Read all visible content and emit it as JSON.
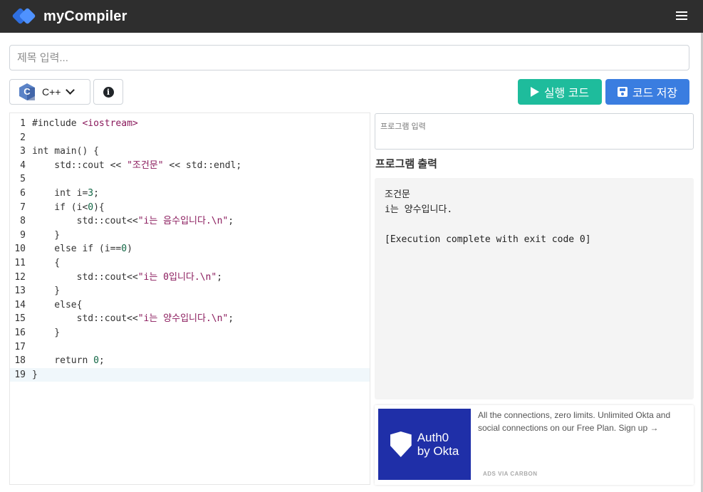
{
  "header": {
    "brand_name": "myCompiler",
    "menu_icon": "hamburger-menu-icon"
  },
  "title_input": {
    "placeholder": "제목 입력...",
    "value": ""
  },
  "toolbar": {
    "language_label": "C++",
    "language_icon": "cpp-icon",
    "info_icon": "info-icon",
    "run_label": "실행 코드",
    "save_label": "코드 저장"
  },
  "colors": {
    "header_bg": "#2e2e2e",
    "run_button": "#1ebc9c",
    "save_button": "#3a7de0",
    "ad_bg": "#1f2fa8"
  },
  "editor": {
    "active_line": 19,
    "lines": [
      {
        "n": "1",
        "parts": [
          {
            "t": "#include ",
            "c": ""
          },
          {
            "t": "<iostream>",
            "c": "str"
          }
        ]
      },
      {
        "n": "2",
        "parts": [
          {
            "t": "",
            "c": ""
          }
        ]
      },
      {
        "n": "3",
        "parts": [
          {
            "t": "int main() {",
            "c": ""
          }
        ]
      },
      {
        "n": "4",
        "parts": [
          {
            "t": "    std::cout << ",
            "c": ""
          },
          {
            "t": "\"조건문\"",
            "c": "str"
          },
          {
            "t": " << std::endl;",
            "c": ""
          }
        ]
      },
      {
        "n": "5",
        "parts": [
          {
            "t": "",
            "c": ""
          }
        ]
      },
      {
        "n": "6",
        "parts": [
          {
            "t": "    int i=",
            "c": ""
          },
          {
            "t": "3",
            "c": "num"
          },
          {
            "t": ";",
            "c": ""
          }
        ]
      },
      {
        "n": "7",
        "parts": [
          {
            "t": "    if (i<",
            "c": ""
          },
          {
            "t": "0",
            "c": "num"
          },
          {
            "t": "){",
            "c": ""
          }
        ]
      },
      {
        "n": "8",
        "parts": [
          {
            "t": "        std::cout<<",
            "c": ""
          },
          {
            "t": "\"i는 음수입니다.\\n\"",
            "c": "str"
          },
          {
            "t": ";",
            "c": ""
          }
        ]
      },
      {
        "n": "9",
        "parts": [
          {
            "t": "    }",
            "c": ""
          }
        ]
      },
      {
        "n": "10",
        "parts": [
          {
            "t": "    else if (i==",
            "c": ""
          },
          {
            "t": "0",
            "c": "num"
          },
          {
            "t": ")",
            "c": ""
          }
        ]
      },
      {
        "n": "11",
        "parts": [
          {
            "t": "    {",
            "c": ""
          }
        ]
      },
      {
        "n": "12",
        "parts": [
          {
            "t": "        std::cout<<",
            "c": ""
          },
          {
            "t": "\"i는 0입니다.\\n\"",
            "c": "str"
          },
          {
            "t": ";",
            "c": ""
          }
        ]
      },
      {
        "n": "13",
        "parts": [
          {
            "t": "    }",
            "c": ""
          }
        ]
      },
      {
        "n": "14",
        "parts": [
          {
            "t": "    else{",
            "c": ""
          }
        ]
      },
      {
        "n": "15",
        "parts": [
          {
            "t": "        std::cout<<",
            "c": ""
          },
          {
            "t": "\"i는 양수입니다.\\n\"",
            "c": "str"
          },
          {
            "t": ";",
            "c": ""
          }
        ]
      },
      {
        "n": "16",
        "parts": [
          {
            "t": "    }",
            "c": ""
          }
        ]
      },
      {
        "n": "17",
        "parts": [
          {
            "t": "",
            "c": ""
          }
        ]
      },
      {
        "n": "18",
        "parts": [
          {
            "t": "    return ",
            "c": ""
          },
          {
            "t": "0",
            "c": "num"
          },
          {
            "t": ";",
            "c": ""
          }
        ]
      },
      {
        "n": "19",
        "parts": [
          {
            "t": "}",
            "c": ""
          }
        ]
      }
    ]
  },
  "stdin": {
    "placeholder": "프로그램 입력",
    "value": ""
  },
  "output": {
    "title": "프로그램 출력",
    "lines": [
      "조건문",
      "i는 양수입니다.",
      "",
      "[Execution complete with exit code 0]"
    ]
  },
  "ad": {
    "brand_line1": "Auth0",
    "brand_line2": "by Okta",
    "text": "All the connections, zero limits. Unlimited Okta and social connections on our Free Plan. Sign up →",
    "via": "ADS VIA CARBON"
  }
}
